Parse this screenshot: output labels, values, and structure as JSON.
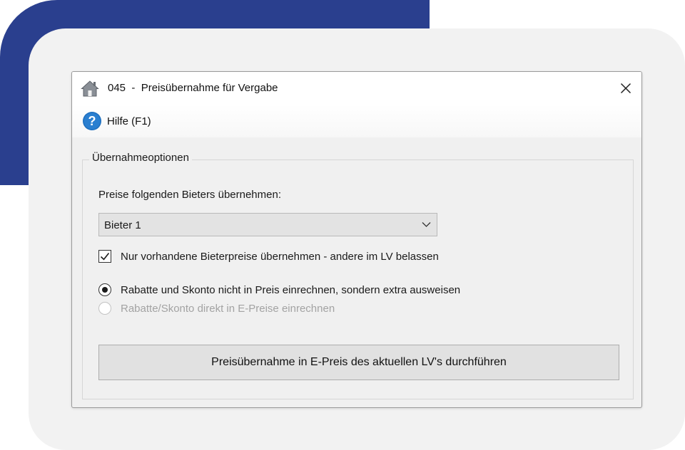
{
  "window": {
    "number": "045",
    "separator": "-",
    "title": "Preisübernahme für Vergabe"
  },
  "menu": {
    "help_label": "Hilfe (F1)"
  },
  "options_group": {
    "legend": "Übernahmeoptionen",
    "bidder_label": "Preise folgenden Bieters übernehmen:",
    "bidder_select": {
      "selected": "Bieter 1"
    },
    "checkbox_existing_only": {
      "label": "Nur vorhandene Bieterpreise übernehmen - andere im LV belassen",
      "checked": true
    },
    "radio_options": [
      {
        "label": "Rabatte und Skonto nicht in Preis einrechnen, sondern extra ausweisen",
        "selected": true,
        "enabled": true
      },
      {
        "label": "Rabatte/Skonto direkt in E-Preise einrechnen",
        "selected": false,
        "enabled": false
      }
    ]
  },
  "actions": {
    "apply_label": "Preisübernahme in E-Preis des aktuellen LV's durchführen"
  },
  "icons": {
    "app": "home-icon",
    "close": "close-icon",
    "help": "help-icon",
    "dropdown": "chevron-down-icon",
    "check": "checkmark-icon"
  },
  "colors": {
    "brand_accent": "#2a3f8e",
    "help_icon": "#1e6fbf",
    "dialog_bg": "#f0f0f0"
  }
}
